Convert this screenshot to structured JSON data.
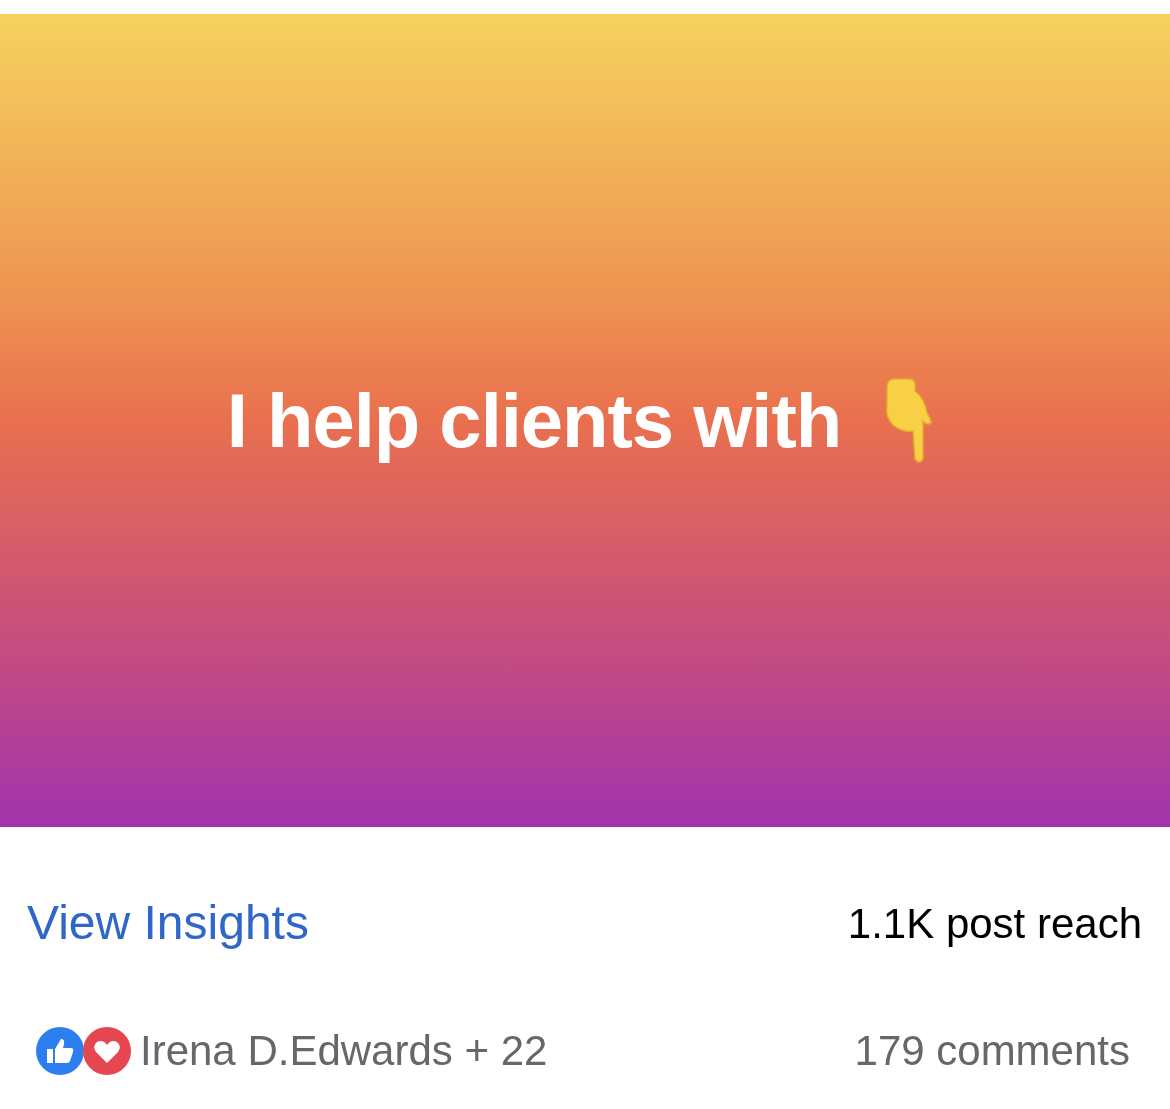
{
  "post": {
    "text": "I help clients with"
  },
  "insights": {
    "link": "View Insights",
    "reach": "1.1K post reach"
  },
  "reactions": {
    "summary": "Irena D.Edwards + 22",
    "comments": "179 comments"
  }
}
